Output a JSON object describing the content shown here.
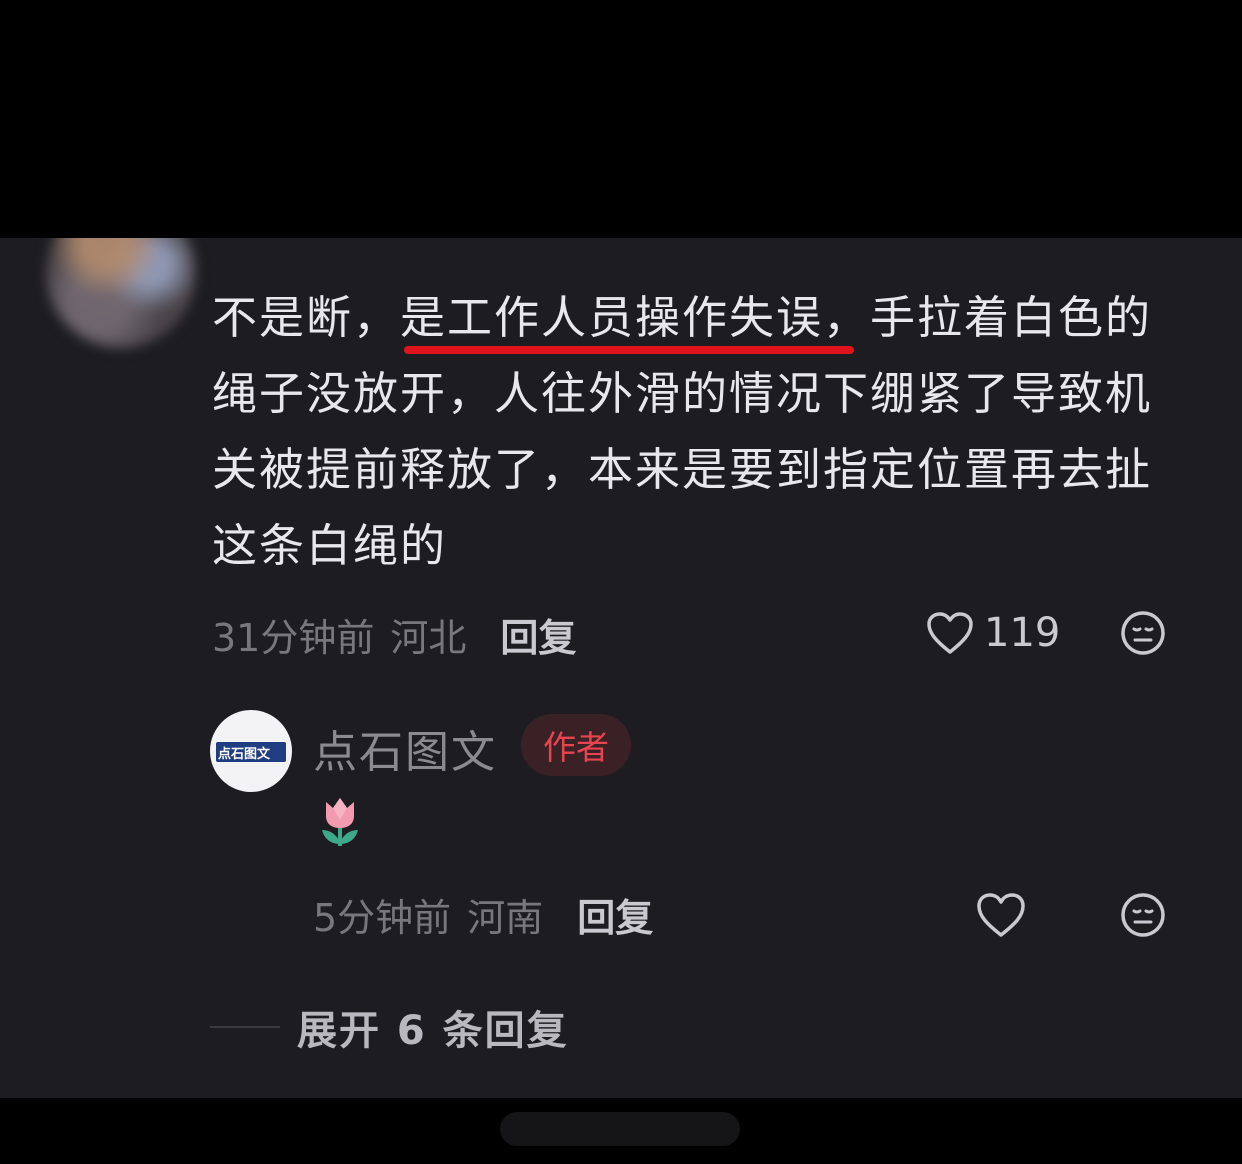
{
  "comment": {
    "text_lines": [
      "不是断，是工作人员操作失误，手拉着白色的",
      "绳子没放开，人往外滑的情况下绷紧了导致机",
      "关被提前释放了，本来是要到指定位置再去扯",
      "这条白绳的"
    ],
    "time": "31分钟前",
    "location": "河北",
    "reply_label": "回复",
    "like_count": "119"
  },
  "reply": {
    "author": "点石图文",
    "avatar_logo_text": "点石图文",
    "author_badge": "作者",
    "emoji": "🌷",
    "time": "5分钟前",
    "location": "河南",
    "reply_label": "回复"
  },
  "expand": {
    "label": "展开 6 条回复"
  },
  "colors": {
    "panel_bg": "#1c1c21",
    "highlight_underline": "#e0141c",
    "author_badge_text": "#e8444f"
  }
}
